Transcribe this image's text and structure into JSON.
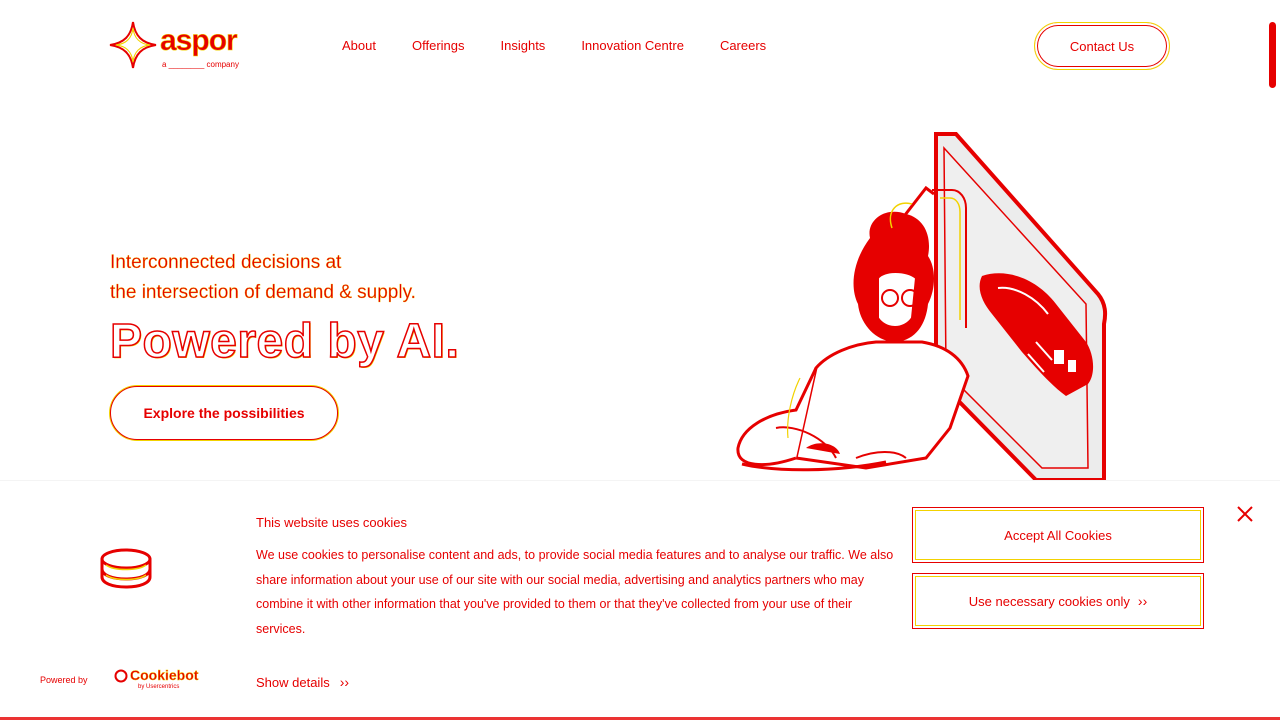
{
  "header": {
    "logo_word": "aspor",
    "logo_tag": "a ________ company",
    "nav": [
      "About",
      "Offerings",
      "Insights",
      "Innovation Centre",
      "Careers"
    ],
    "contact_label": "Contact Us"
  },
  "hero": {
    "line1": "Interconnected decisions at",
    "line2": "the intersection of demand & supply.",
    "power": "Powered by AI.",
    "cta_label": "Explore the possibilities"
  },
  "cookie": {
    "title": "This website uses cookies",
    "body": "We use cookies to personalise content and ads, to provide social media features and to analyse our traffic. We also share information about your use of our site with our social media, advertising and analytics partners who may combine it with other information that you've provided to them or that they've collected from your use of their services.",
    "accept_label": "Accept All Cookies",
    "necessary_label": "Use necessary cookies only",
    "show_details_label": "Show details",
    "powered_by": "Powered by",
    "cookiebot_name": "Cookiebot",
    "cookiebot_sub": "by Usercentrics"
  },
  "colors": {
    "accent": "#e60000",
    "secondary": "#f2d200",
    "background": "#ffffff"
  },
  "icons": {
    "logo": "four-point-star-logo",
    "cookie": "cookie-stack-icon",
    "close": "close-icon",
    "chevron": "chevron-right-icon"
  }
}
